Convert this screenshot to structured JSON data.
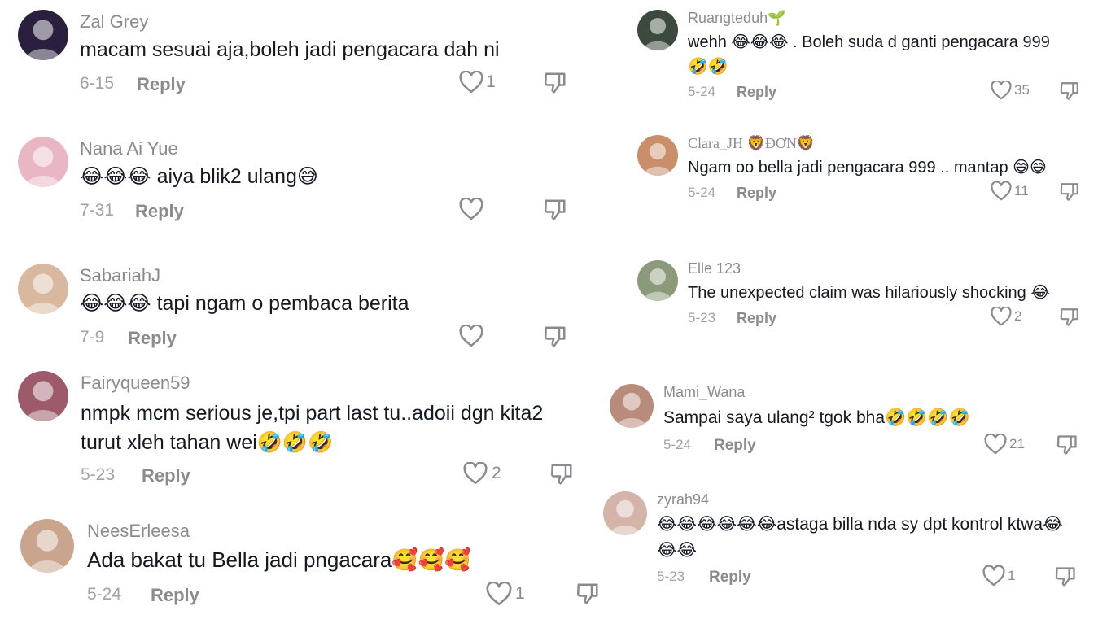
{
  "left_column": [
    {
      "username": "Zal Grey",
      "text": "macam sesuai aja,boleh jadi pengacara dah ni",
      "date": "6-15",
      "reply": "Reply",
      "likes": "1",
      "avatar_color": "#2a1f3d"
    },
    {
      "username": "Nana Ai Yue",
      "text": "😂😂😂 aiya blik2 ulang😅",
      "date": "7-31",
      "reply": "Reply",
      "likes": "",
      "avatar_color": "#e9b7c4"
    },
    {
      "username": "SabariahJ",
      "text": "😂😂😂 tapi ngam o pembaca berita",
      "date": "7-9",
      "reply": "Reply",
      "likes": "",
      "avatar_color": "#d9b8a0"
    },
    {
      "username": "Fairyqueen59",
      "text": "nmpk mcm serious je,tpi part last tu..adoii dgn kita2 turut xleh tahan wei🤣🤣🤣",
      "date": "5-23",
      "reply": "Reply",
      "likes": "2",
      "avatar_color": "#9c5a6a"
    },
    {
      "username": "NeesErleesa",
      "text": "Ada bakat tu Bella jadi pngacara🥰🥰🥰",
      "date": "5-24",
      "reply": "Reply",
      "likes": "1",
      "avatar_color": "#caa58e"
    }
  ],
  "right_column": [
    {
      "username": "Ruangteduh🌱",
      "text": "wehh 😂😂😂 . Boleh suda d ganti pengacara 999 🤣🤣",
      "date": "5-24",
      "reply": "Reply",
      "likes": "35",
      "avatar_color": "#3b4a3c"
    },
    {
      "username": "Clara_JH 🦁ĐƠN🦁",
      "text": "Ngam oo bella jadi pengacara 999 .. mantap 😅😅",
      "date": "5-24",
      "reply": "Reply",
      "likes": "11",
      "avatar_color": "#c98f6a"
    },
    {
      "username": "Elle 123",
      "text": "The unexpected claim was hilariously shocking 😂",
      "date": "5-23",
      "reply": "Reply",
      "likes": "2",
      "avatar_color": "#8a9a7a"
    },
    {
      "username": "Mami_Wana",
      "text": "Sampai saya ulang² tgok bha🤣🤣🤣🤣",
      "date": "5-24",
      "reply": "Reply",
      "likes": "21",
      "avatar_color": "#b88b7a"
    },
    {
      "username": "zyrah94",
      "text": "😂😂😂😂😂😂astaga billa nda sy dpt kontrol ktwa😂😂😂",
      "date": "5-23",
      "reply": "Reply",
      "likes": "1",
      "avatar_color": "#d4b3a8"
    }
  ]
}
